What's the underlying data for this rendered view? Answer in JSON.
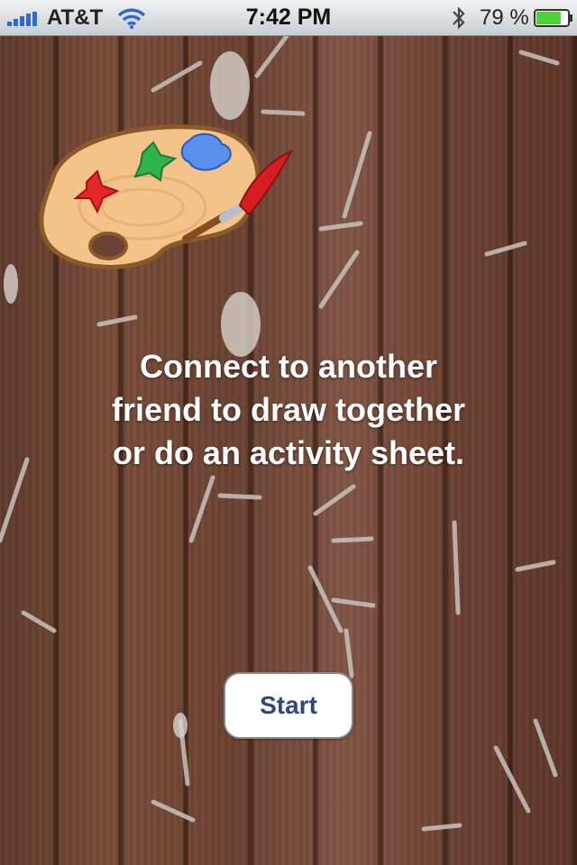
{
  "status_bar": {
    "carrier": "AT&T",
    "time": "7:42 PM",
    "battery": "79 %",
    "icons": [
      "signal-bars-icon",
      "wifi-icon",
      "bluetooth-icon",
      "battery-icon"
    ],
    "battery_level": 0.79,
    "battery_color": "#4cd137"
  },
  "main": {
    "background": "wood-planks-with-staples",
    "logo_icon": "paint-palette-icon",
    "message": "Connect to another friend to draw together or do an activity sheet.",
    "start_label": "Start"
  },
  "colors": {
    "button_text": "#2e4a7d",
    "message_text": "#ffffff"
  }
}
